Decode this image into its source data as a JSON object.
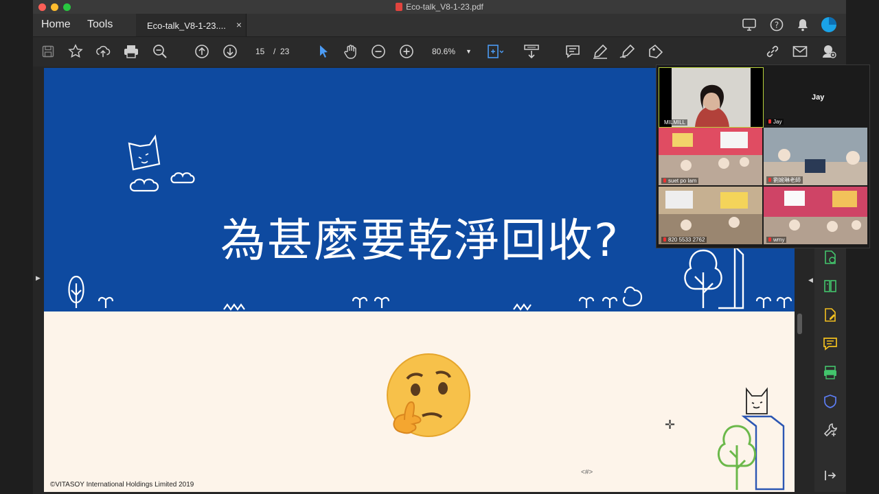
{
  "window": {
    "title": "Eco-talk_V8-1-23.pdf",
    "traffic_colors": [
      "#ff5f57",
      "#febc2e",
      "#28c840"
    ]
  },
  "tabs": {
    "home": "Home",
    "tools": "Tools",
    "document": "Eco-talk_V8-1-23....",
    "close": "×"
  },
  "toolbar": {
    "page_current": "15",
    "page_sep": "/",
    "page_total": "23",
    "zoom_level": "80.6%"
  },
  "slide": {
    "headline": "為甚麼要乾淨回收?",
    "copyright": "©VITASOY International Holdings Limited 2019",
    "page_placeholder": "<#>",
    "top_color": "#0e4aa0",
    "bottom_color": "#fdf4ea"
  },
  "zoom": {
    "self_name": "MILMILL",
    "jay_label": "Jay",
    "jay_name": "Jay",
    "participants": [
      "suet po lam",
      "劉婉琳老師",
      "820 5533 2762",
      "wmy"
    ]
  },
  "icons": [
    "save-icon",
    "star-icon",
    "cloud-upload-icon",
    "print-icon",
    "zoom-out-search-icon",
    "arrow-up-circle-icon",
    "arrow-down-circle-icon",
    "select-arrow-icon",
    "hand-icon",
    "minus-circle-icon",
    "plus-circle-icon",
    "fit-page-icon",
    "scroll-mode-icon",
    "comment-icon",
    "highlight-pen-icon",
    "sign-icon",
    "fill-sign-icon",
    "link-icon",
    "mail-icon",
    "user-add-icon",
    "share-screen-icon",
    "help-icon",
    "bell-icon",
    "account-icon"
  ]
}
